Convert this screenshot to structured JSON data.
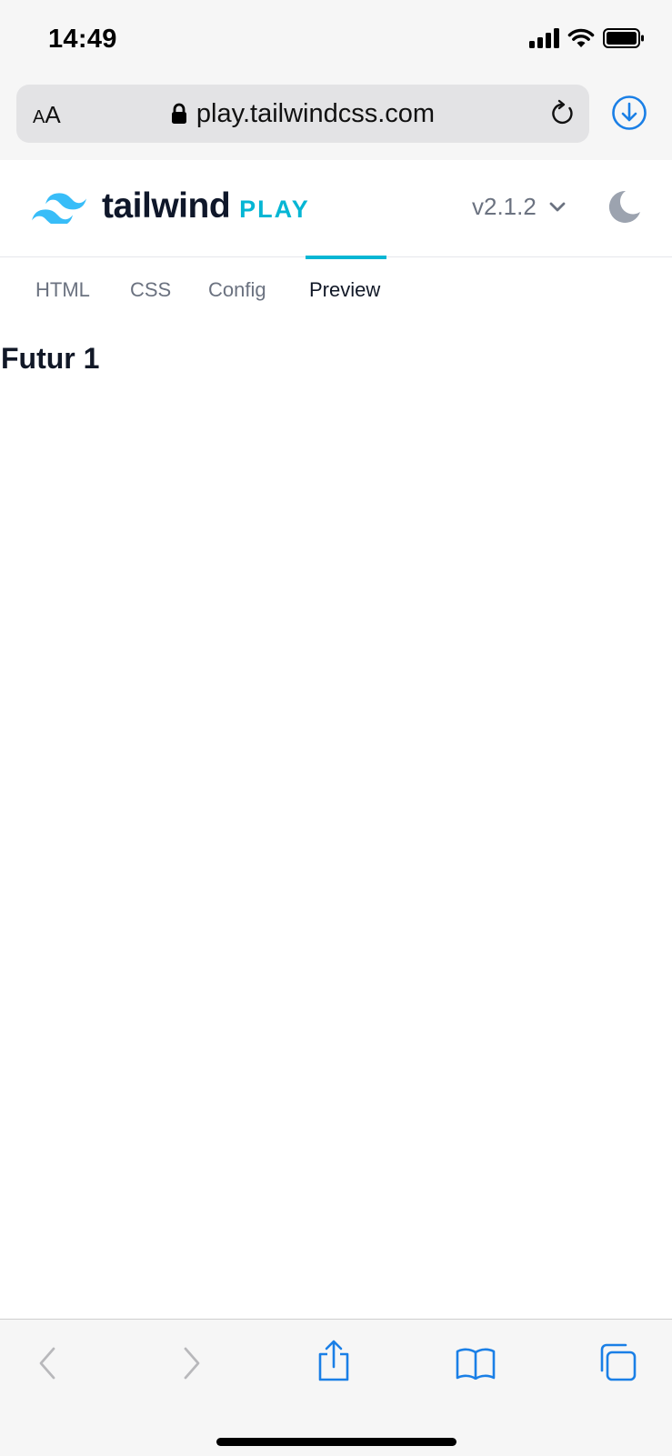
{
  "status_bar": {
    "time": "14:49"
  },
  "browser": {
    "text_size_label_small": "A",
    "text_size_label_large": "A",
    "url": "play.tailwindcss.com"
  },
  "header": {
    "brand_name": "tailwind",
    "brand_suffix": "PLAY",
    "version": "v2.1.2"
  },
  "tabs": [
    {
      "label": "HTML",
      "active": false
    },
    {
      "label": "CSS",
      "active": false
    },
    {
      "label": "Config",
      "active": false
    },
    {
      "label": "Preview",
      "active": true
    }
  ],
  "preview": {
    "heading": "Futur 1"
  },
  "colors": {
    "accent": "#06b6d4",
    "ios_blue": "#1a7fe6",
    "text_dark": "#111827",
    "text_muted": "#6b7280"
  }
}
